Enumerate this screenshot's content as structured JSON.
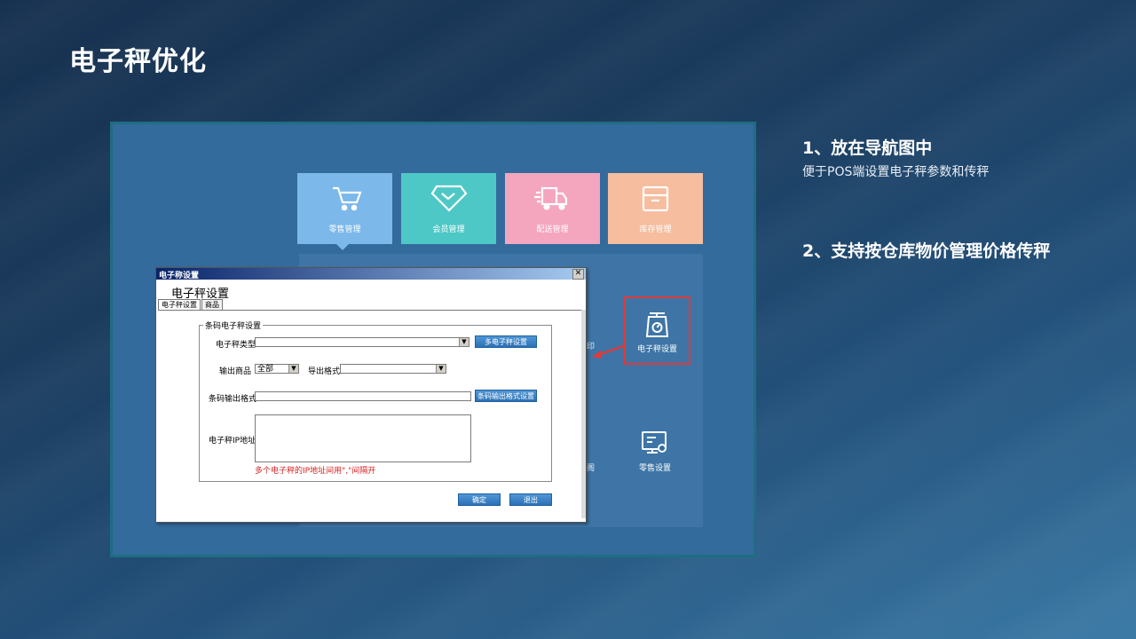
{
  "slide": {
    "title": "电子秤优化"
  },
  "nav_tiles": [
    {
      "label": "零售管理",
      "icon": "cart-icon",
      "color": "#7cb8ea"
    },
    {
      "label": "会员管理",
      "icon": "diamond-icon",
      "color": "#4ec8c6"
    },
    {
      "label": "配送管理",
      "icon": "truck-icon",
      "color": "#f4a6bf"
    },
    {
      "label": "库存管理",
      "icon": "box-icon",
      "color": "#f6bd9e"
    }
  ],
  "nav_items": {
    "scale_settings": "电子秤设置",
    "retail_settings": "零售设置",
    "fragment_1": "印",
    "fragment_2": "阁"
  },
  "dialog": {
    "window_title": "电子称设置",
    "heading": "电子秤设置",
    "tabs": [
      "电子秤设置",
      "商品"
    ],
    "group_title": "条码电子秤设置",
    "scale_type_label": "电子秤类型",
    "scale_type_value": "",
    "multi_scale_button": "多电子秤设置",
    "output_goods_label": "输出商品",
    "output_goods_value": "全部",
    "export_format_label": "导出格式",
    "export_format_value": "",
    "barcode_format_label": "条码输出格式",
    "barcode_format_value": "",
    "barcode_format_button": "条码输出格式设置",
    "ip_label": "电子秤IP地址",
    "ip_value": "",
    "hint": "多个电子秤的IP地址间用\",\"间隔开",
    "ok_button": "确定",
    "exit_button": "退出",
    "close_glyph": "✕",
    "dropdown_glyph": "▼"
  },
  "points": [
    {
      "title": "1、放在导航图中",
      "desc": "便于POS端设置电子秤参数和传秤"
    },
    {
      "title": "2、支持按仓库物价管理价格传秤"
    }
  ],
  "colors": {
    "highlight": "#e03a3a",
    "frame_border": "#1f6d82"
  }
}
